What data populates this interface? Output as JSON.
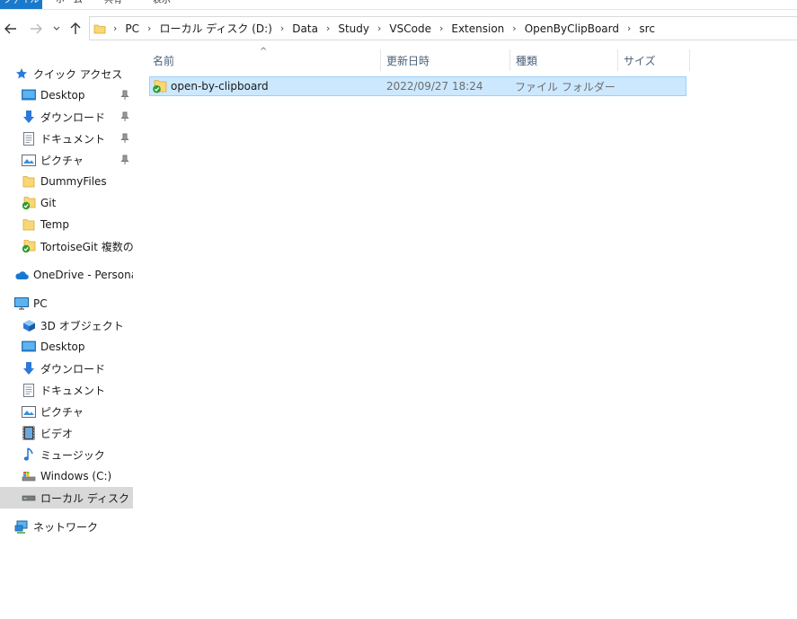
{
  "ribbon": {
    "tabs": [
      "ファイル",
      "ホーム",
      "共有",
      "表示"
    ]
  },
  "address": {
    "crumbs": [
      "PC",
      "ローカル ディスク (D:)",
      "Data",
      "Study",
      "VSCode",
      "Extension",
      "OpenByClipBoard",
      "src"
    ]
  },
  "sidebar": {
    "quick_access": "クイック アクセス",
    "quick_items": [
      "Desktop",
      "ダウンロード",
      "ドキュメント",
      "ピクチャ",
      "DummyFiles",
      "Git",
      "Temp",
      "TortoiseGit 複数のコ"
    ],
    "onedrive": "OneDrive - Personal",
    "pc": "PC",
    "pc_items": [
      "3D オブジェクト",
      "Desktop",
      "ダウンロード",
      "ドキュメント",
      "ピクチャ",
      "ビデオ",
      "ミュージック",
      "Windows (C:)",
      "ローカル ディスク (D:)"
    ],
    "network": "ネットワーク"
  },
  "columns": {
    "name": "名前",
    "modified": "更新日時",
    "type": "種類",
    "size": "サイズ"
  },
  "files": [
    {
      "name": "open-by-clipboard",
      "modified": "2022/09/27 18:24",
      "type": "ファイル フォルダー",
      "size": ""
    }
  ],
  "colors": {
    "accent": "#1979ca",
    "selection": "#cce8ff",
    "selection_border": "#99d1ff",
    "folder": "#f8d775",
    "sync_ok": "#2e9c2e"
  }
}
